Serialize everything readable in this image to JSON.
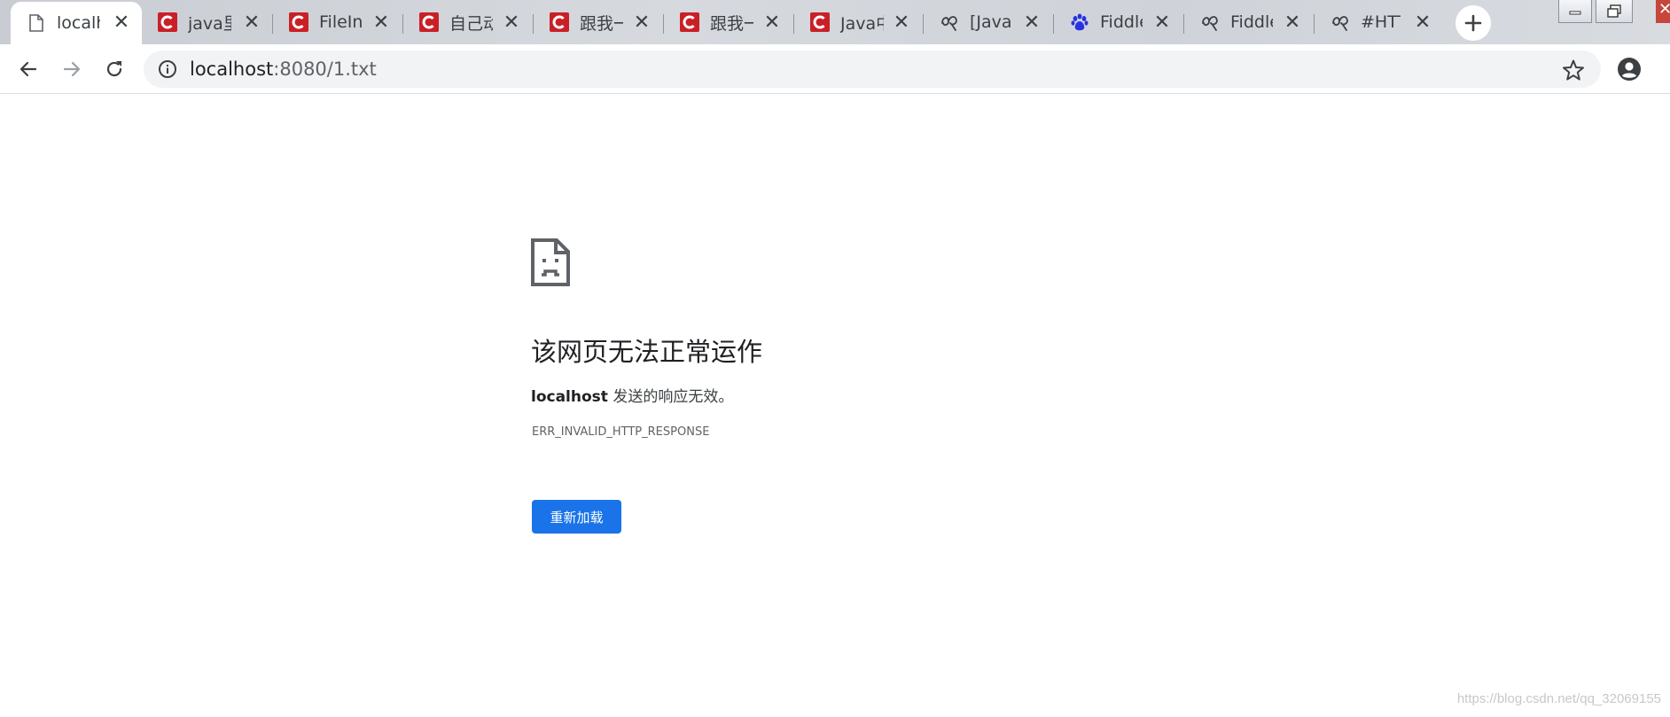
{
  "tabs": [
    {
      "title": "localh",
      "icon": "document-icon",
      "active": true
    },
    {
      "title": "java里",
      "icon": "csdn-icon"
    },
    {
      "title": "FileIn",
      "icon": "csdn-icon"
    },
    {
      "title": "自己动",
      "icon": "csdn-icon"
    },
    {
      "title": "跟我一",
      "icon": "csdn-icon"
    },
    {
      "title": "跟我一",
      "icon": "csdn-icon"
    },
    {
      "title": "Java中",
      "icon": "csdn-icon"
    },
    {
      "title": "[Java]",
      "icon": "cnblogs-icon"
    },
    {
      "title": "Fiddle",
      "icon": "baidu-paw-icon"
    },
    {
      "title": "Fiddle",
      "icon": "cnblogs-icon"
    },
    {
      "title": "#HTT",
      "icon": "cnblogs-icon"
    }
  ],
  "tab_close_glyph": "✕",
  "window": {
    "close_glyph": "✕"
  },
  "address_bar": {
    "host": "localhost",
    "path": ":8080/1.txt"
  },
  "error": {
    "title": "该网页无法正常运作",
    "host": "localhost",
    "message": " 发送的响应无效。",
    "code": "ERR_INVALID_HTTP_RESPONSE",
    "reload_label": "重新加载"
  },
  "watermark": "https://blog.csdn.net/qq_32069155",
  "colors": {
    "accent": "#1a73e8",
    "csdn": "#c92027",
    "baidu": "#2932e1"
  }
}
